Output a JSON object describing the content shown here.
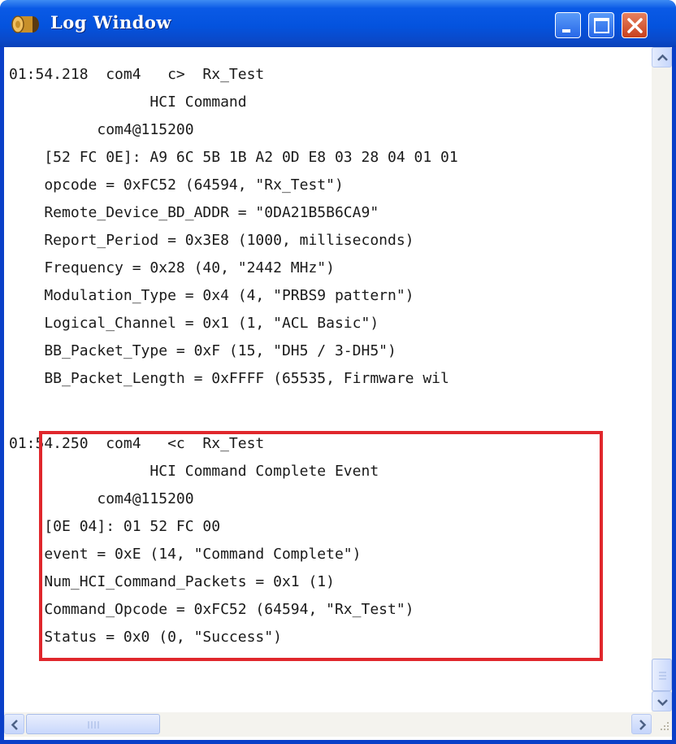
{
  "window": {
    "title": "Log Window",
    "buttons": {
      "minimize": "minimize",
      "maximize": "maximize",
      "close": "close"
    },
    "accent": "#0453de",
    "highlight_color": "#e0272c"
  },
  "log": {
    "lines": [
      "01:54.218  com4   c>  Rx_Test",
      "                HCI Command",
      "          com4@115200",
      "    [52 FC 0E]: A9 6C 5B 1B A2 0D E8 03 28 04 01 01",
      "    opcode = 0xFC52 (64594, \"Rx_Test\")",
      "    Remote_Device_BD_ADDR = \"0DA21B5B6CA9\"",
      "    Report_Period = 0x3E8 (1000, milliseconds)",
      "    Frequency = 0x28 (40, \"2442 MHz\")",
      "    Modulation_Type = 0x4 (4, \"PRBS9 pattern\")",
      "    Logical_Channel = 0x1 (1, \"ACL Basic\")",
      "    BB_Packet_Type = 0xF (15, \"DH5 / 3-DH5\")",
      "    BB_Packet_Length = 0xFFFF (65535, Firmware wil",
      "",
      "01:54.250  com4   <c  Rx_Test",
      "                HCI Command Complete Event",
      "          com4@115200",
      "    [0E 04]: 01 52 FC 00",
      "    event = 0xE (14, \"Command Complete\")",
      "    Num_HCI_Command_Packets = 0x1 (1)",
      "    Command_Opcode = 0xFC52 (64594, \"Rx_Test\")",
      "    Status = 0x0 (0, \"Success\")"
    ]
  },
  "scrollbars": {
    "vertical": {
      "up_icon": "arrow-up-icon",
      "down_icon": "arrow-down-icon"
    },
    "horizontal": {
      "left_icon": "arrow-left-icon",
      "right_icon": "arrow-right-icon"
    }
  }
}
